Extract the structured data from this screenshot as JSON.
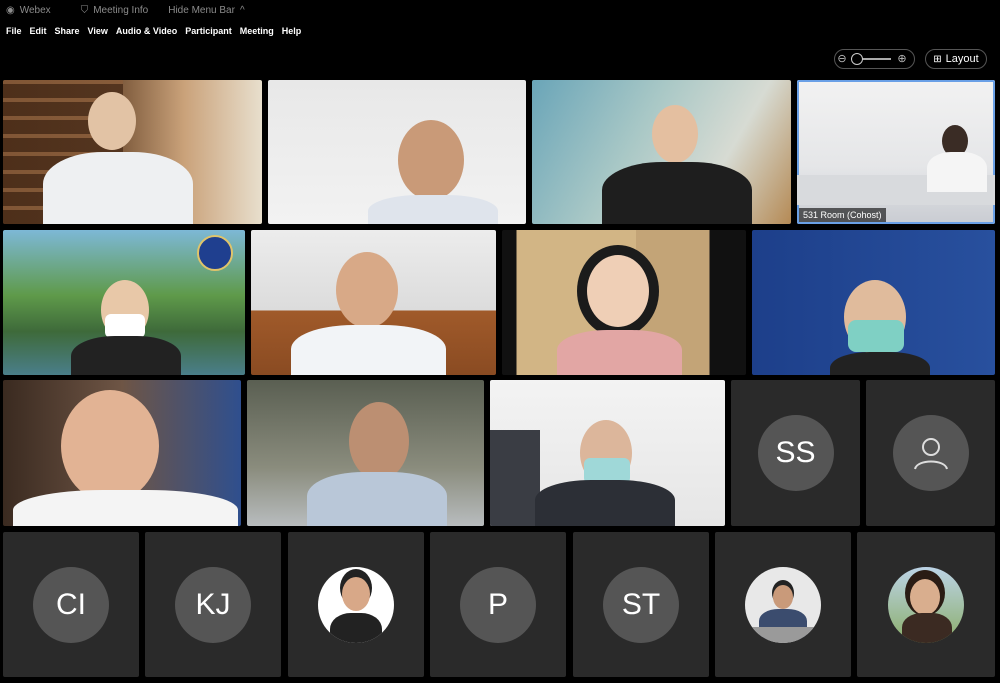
{
  "titlebar": {
    "app": "Webex",
    "meeting_info": "Meeting Info",
    "hide_menu_bar": "Hide Menu Bar"
  },
  "menu": [
    "File",
    "Edit",
    "Share",
    "View",
    "Audio & Video",
    "Participant",
    "Meeting",
    "Help"
  ],
  "controls": {
    "layout_label": "Layout",
    "zoom_icon_out": "zoom-out-icon",
    "zoom_icon_in": "zoom-in-icon"
  },
  "tiles": {
    "room_label": "531 Room (Cohost)",
    "initials": [
      "SS",
      "CI",
      "KJ",
      "P",
      "ST"
    ]
  }
}
